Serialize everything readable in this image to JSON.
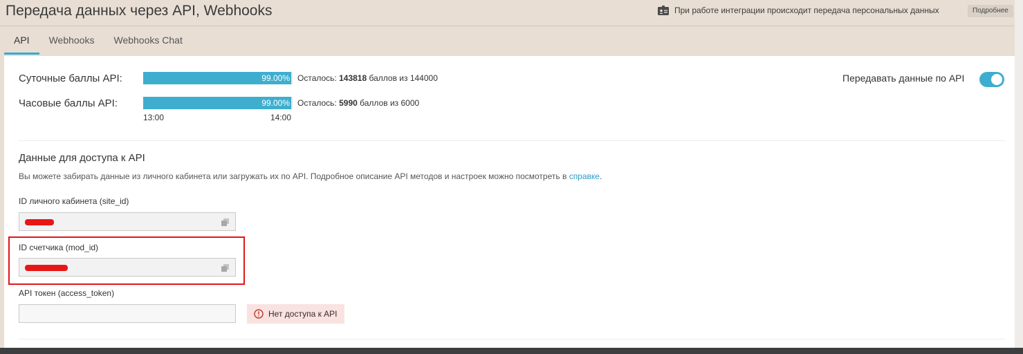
{
  "header": {
    "title": "Передача данных через API, Webhooks",
    "notice": "При работе интеграции происходит передача персональных данных",
    "more_button": "Подробнее"
  },
  "tabs": [
    {
      "label": "API",
      "active": true
    },
    {
      "label": "Webhooks",
      "active": false
    },
    {
      "label": "Webhooks Chat",
      "active": false
    }
  ],
  "scores": {
    "daily": {
      "label": "Суточные баллы API:",
      "percent_text": "99.00%",
      "percent": 99.0,
      "remain_prefix": "Осталось:",
      "remain_value": "143818",
      "remain_suffix": "баллов из 144000"
    },
    "hourly": {
      "label": "Часовые баллы API:",
      "percent_text": "99.00%",
      "percent": 99.0,
      "remain_prefix": "Осталось:",
      "remain_value": "5990",
      "remain_suffix": "баллов из 6000"
    },
    "time_start": "13:00",
    "time_end": "14:00"
  },
  "api_toggle": {
    "label": "Передавать данные по API",
    "enabled": true
  },
  "access": {
    "title": "Данные для доступа к API",
    "description": "Вы можете забирать данные из личного кабинета или загружать их по API. Подробное описание API методов и настроек можно посмотреть в",
    "help_link": "справке",
    "description_end": ".",
    "site_id_label": "ID личного кабинета (site_id)",
    "mod_id_label": "ID счетчика (mod_id)",
    "token_label": "API токен (access_token)",
    "token_value": "",
    "no_access_text": "Нет доступа к API"
  },
  "colors": {
    "accent": "#3eaecf",
    "highlight": "#e21515",
    "alert_bg": "#f9e2e0"
  },
  "icons": {
    "notice": "id-card-icon",
    "copy": "copy-icon",
    "alert": "exclamation-circle-icon"
  }
}
